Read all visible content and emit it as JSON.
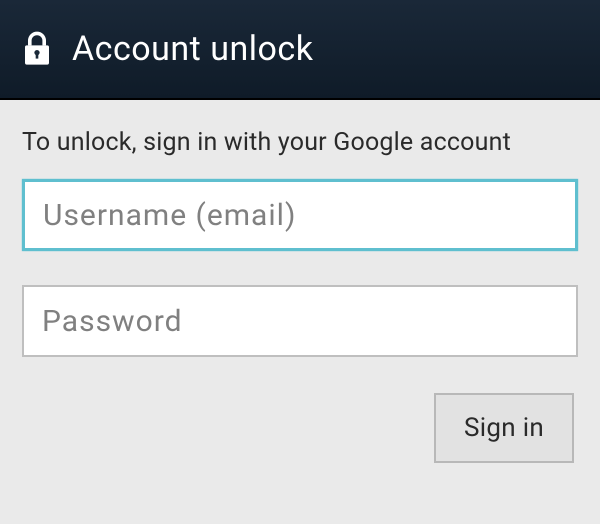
{
  "header": {
    "title": "Account unlock"
  },
  "content": {
    "instruction": "To unlock, sign in with your Google account",
    "username_placeholder": "Username (email)",
    "password_placeholder": "Password",
    "username_value": "",
    "password_value": ""
  },
  "actions": {
    "signin_label": "Sign in"
  }
}
